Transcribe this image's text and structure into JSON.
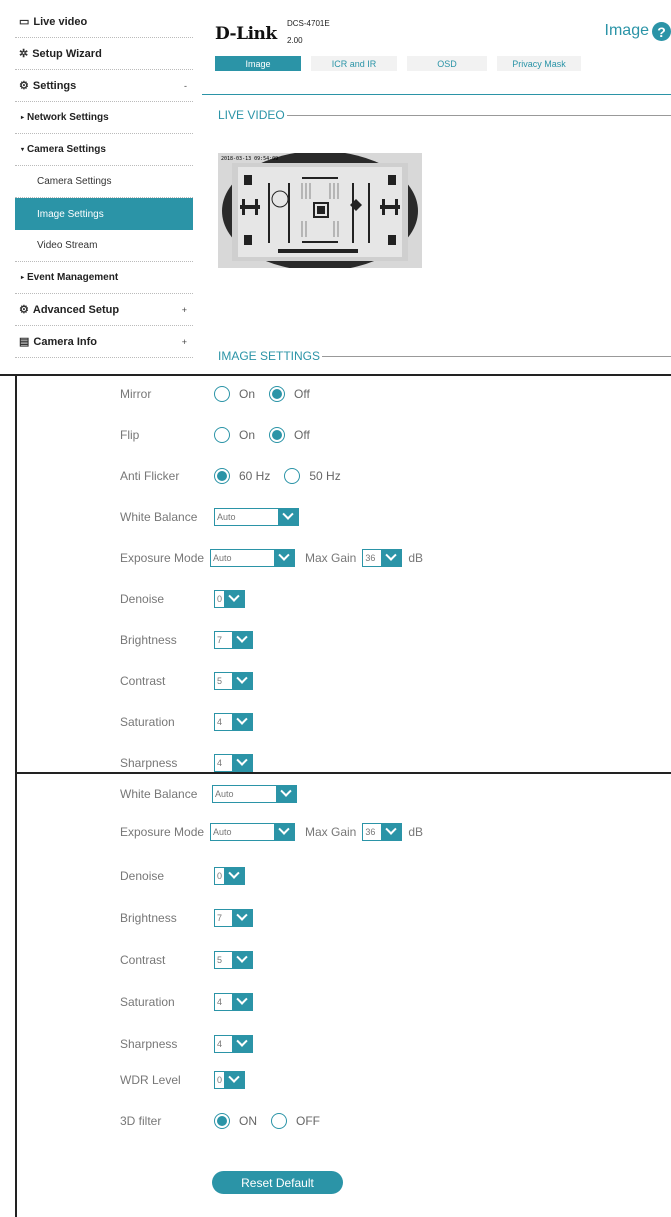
{
  "sidebar": {
    "items": [
      {
        "label": "Live video",
        "icon": "video-icon",
        "toggle": ""
      },
      {
        "label": "Setup Wizard",
        "icon": "wizard-icon",
        "toggle": ""
      },
      {
        "label": "Settings",
        "icon": "gear-icon",
        "toggle": "-"
      },
      {
        "label": "Network Settings"
      },
      {
        "label": "Camera Settings"
      },
      {
        "label": "Camera Settings"
      },
      {
        "label": "Image Settings"
      },
      {
        "label": "Video Stream"
      },
      {
        "label": "Event Management"
      },
      {
        "label": "Advanced Setup",
        "icon": "advanced-gear-icon",
        "toggle": "+"
      },
      {
        "label": "Camera Info",
        "icon": "info-icon",
        "toggle": "+"
      }
    ]
  },
  "header": {
    "logo": "D-Link",
    "model": "DCS-4701E",
    "firmware": "2.00",
    "page_title": "Image",
    "help": "?"
  },
  "tabs": [
    {
      "label": "Image"
    },
    {
      "label": "ICR and IR"
    },
    {
      "label": "OSD"
    },
    {
      "label": "Privacy Mask"
    }
  ],
  "sections": {
    "live_video": "LIVE VIDEO",
    "image_settings": "IMAGE SETTINGS"
  },
  "live_timestamp": "2018-03-13 09:54:09",
  "form": {
    "mirror": {
      "label": "Mirror",
      "on": "On",
      "off": "Off",
      "value": "Off"
    },
    "flip": {
      "label": "Flip",
      "on": "On",
      "off": "Off",
      "value": "Off"
    },
    "anti_flicker": {
      "label": "Anti Flicker",
      "opt1": "60 Hz",
      "opt2": "50 Hz",
      "value": "60 Hz"
    },
    "white_balance": {
      "label": "White Balance",
      "value": "Auto"
    },
    "exposure_mode": {
      "label": "Exposure Mode",
      "value": "Auto",
      "max_gain_label": "Max Gain",
      "max_gain": "36",
      "unit": "dB"
    },
    "denoise": {
      "label": "Denoise",
      "value": "0"
    },
    "brightness": {
      "label": "Brightness",
      "value": "7"
    },
    "contrast": {
      "label": "Contrast",
      "value": "5"
    },
    "saturation": {
      "label": "Saturation",
      "value": "4"
    },
    "sharpness": {
      "label": "Sharpness",
      "value": "4"
    },
    "wdr_level": {
      "label": "WDR Level",
      "value": "0"
    },
    "filter3d": {
      "label": "3D filter",
      "on": "ON",
      "off": "OFF",
      "value": "ON"
    },
    "reset": "Reset Default"
  }
}
